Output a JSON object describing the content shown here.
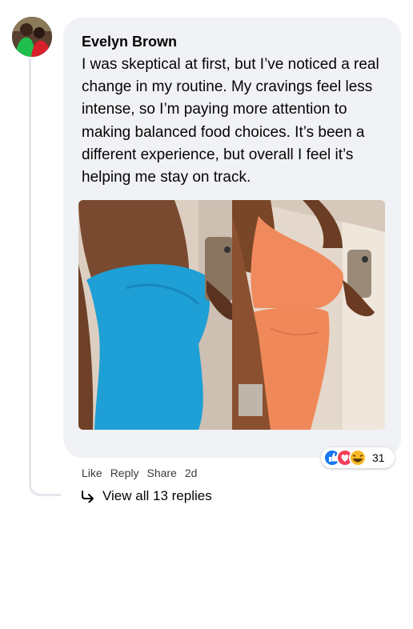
{
  "comment": {
    "author": "Evelyn Brown",
    "text": "I was skeptical at first, but I’ve noticed a real change in my routine. My cravings feel less intense, so I’m paying more attention to making balanced food choices. It’s been a different experience, but overall I feel it’s helping me stay on track.",
    "photo": "before-after-photo",
    "reactions": {
      "icons": [
        "like-reaction-icon",
        "love-reaction-icon",
        "haha-reaction-icon"
      ],
      "count": "31"
    },
    "actions": {
      "like": "Like",
      "reply": "Reply",
      "share": "Share",
      "time": "2d"
    },
    "view_replies": "View all 13 replies"
  },
  "colors": {
    "bubble": "#f0f2f5",
    "like_blue": "#1877f2",
    "love_red": "#f33e58",
    "haha_yellow": "#f7b928"
  }
}
